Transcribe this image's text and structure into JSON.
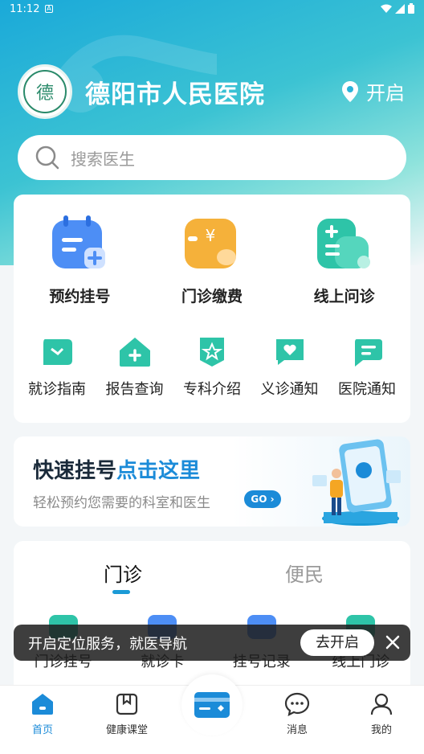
{
  "status_bar": {
    "time": "11:12",
    "notif": "A"
  },
  "header": {
    "hospital_name": "德阳市人民医院",
    "location_label": "开启",
    "logo_char": "德"
  },
  "search": {
    "placeholder": "搜索医生"
  },
  "main_services": [
    {
      "label": "预约挂号",
      "icon": "calendar-icon"
    },
    {
      "label": "门诊缴费",
      "icon": "wallet-icon"
    },
    {
      "label": "线上问诊",
      "icon": "medical-icon"
    }
  ],
  "sub_services": [
    {
      "label": "就诊指南",
      "icon": "guide-icon"
    },
    {
      "label": "报告查询",
      "icon": "report-icon"
    },
    {
      "label": "专科介绍",
      "icon": "specialty-icon"
    },
    {
      "label": "义诊通知",
      "icon": "heart-chat-icon"
    },
    {
      "label": "医院通知",
      "icon": "notice-icon"
    }
  ],
  "banner": {
    "title_a": "快速挂号",
    "title_b": "点击这里",
    "subtitle": "轻松预约您需要的科室和医生",
    "go": "GO"
  },
  "tabs": [
    {
      "label": "门诊",
      "active": true
    },
    {
      "label": "便民",
      "active": false
    }
  ],
  "quick_items": [
    {
      "label": "门诊挂号"
    },
    {
      "label": "就诊卡"
    },
    {
      "label": "挂号记录"
    },
    {
      "label": "线上门诊"
    }
  ],
  "toast": {
    "message": "开启定位服务，就医导航",
    "button": "去开启"
  },
  "nav": [
    {
      "label": "首页",
      "icon": "home-icon",
      "active": true
    },
    {
      "label": "健康课堂",
      "icon": "book-icon",
      "active": false
    },
    {
      "label": "",
      "icon": "card-icon",
      "active": false
    },
    {
      "label": "消息",
      "icon": "message-icon",
      "active": false
    },
    {
      "label": "我的",
      "icon": "user-icon",
      "active": false
    }
  ],
  "colors": {
    "primary": "#1b8bd8",
    "teal": "#2ec4a8",
    "orange": "#f5a623",
    "header_gradient_start": "#1aa9d9"
  }
}
